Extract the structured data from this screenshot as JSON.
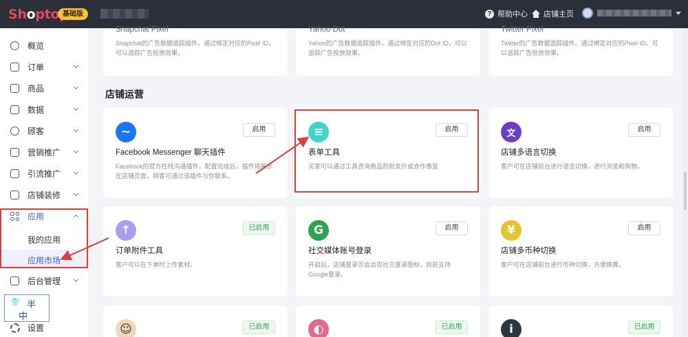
{
  "header": {
    "logo": {
      "part1": "Sh",
      "part2": "o",
      "part3": "ptop"
    },
    "plan_badge": "基础版",
    "help_label": "帮助中心",
    "store_home_label": "店铺主页"
  },
  "sidebar": {
    "items": [
      {
        "label": "概览",
        "icon": "dashboard-icon"
      },
      {
        "label": "订单",
        "icon": "order-icon"
      },
      {
        "label": "商品",
        "icon": "product-icon"
      },
      {
        "label": "数据",
        "icon": "data-icon"
      },
      {
        "label": "顾客",
        "icon": "customer-icon"
      },
      {
        "label": "营销推广",
        "icon": "marketing-icon"
      },
      {
        "label": "引流推广",
        "icon": "traffic-icon"
      },
      {
        "label": "店铺装修",
        "icon": "decoration-icon"
      },
      {
        "label": "应用",
        "icon": "apps-icon"
      },
      {
        "label": "后台管理",
        "icon": "admin-icon"
      },
      {
        "label": "设置",
        "icon": "settings-icon"
      }
    ],
    "apps_sub": [
      {
        "label": "我的应用"
      },
      {
        "label": "应用市场"
      }
    ]
  },
  "watermark": {
    "a": "👕",
    "b": "半",
    "c": "中"
  },
  "main": {
    "top_row": [
      {
        "name": "Snapchat Pixel",
        "desc": "Snapchat的广告数据追踪插件。通过绑定对应的Pixel ID，可以追踪广告投放效果。"
      },
      {
        "name": "Yahoo Dot",
        "desc": "Yahoo的广告数据追踪插件。通过绑定对应的Dot ID，可以追踪广告投放效果。"
      },
      {
        "name": "Twitter Pixel",
        "desc": "Twitter的广告数据追踪插件。通过绑定对应的Pixel ID，可以追踪广告投放效果。"
      }
    ],
    "section_title": "店铺运营",
    "cards": [
      {
        "name": "Facebook Messenger 聊天插件",
        "desc": "Facebook的官方在线沟通插件，配置完成后，插件将展示在店铺页面，顾客可通过该插件与你联系。",
        "button": "启用",
        "icon_color": "#1877f2",
        "icon_glyph": "~"
      },
      {
        "name": "表单工具",
        "desc": "买家可以通过工具咨询商品的批发价或合作事宜",
        "button": "启用",
        "icon_color": "#3dd6c8",
        "icon_glyph": "≡"
      },
      {
        "name": "店铺多语言切换",
        "desc": "客户可在店铺前台进行语言切换，进行浏览和购物。",
        "button": "启用",
        "icon_color": "#6a3fc6",
        "icon_glyph": "文"
      },
      {
        "name": "订单附件工具",
        "desc": "客户可以在下单时上传素材。",
        "button": "已启用",
        "icon_color": "#a99cf2",
        "icon_glyph": "↑"
      },
      {
        "name": "社交媒体账号登录",
        "desc": "开启后，店铺登录页会出现社交登录图标，目前支持Google登录。",
        "button": "启用",
        "icon_color": "#2ea44f",
        "icon_glyph": "G"
      },
      {
        "name": "店铺多币种切换",
        "desc": "客户可在店铺前台进行币种切换，方便换算。",
        "button": "启用",
        "icon_color": "#e9c22f",
        "icon_glyph": "¥"
      },
      {
        "name": "",
        "desc": "",
        "button": "已启用",
        "icon_color": "#f0d6b8",
        "icon_glyph": "☺"
      },
      {
        "name": "",
        "desc": "",
        "button": "已启用",
        "icon_color": "#e26a8a",
        "icon_glyph": "◐"
      },
      {
        "name": "",
        "desc": "",
        "button": "已启用",
        "icon_color": "#2f3540",
        "icon_glyph": "i"
      }
    ]
  }
}
